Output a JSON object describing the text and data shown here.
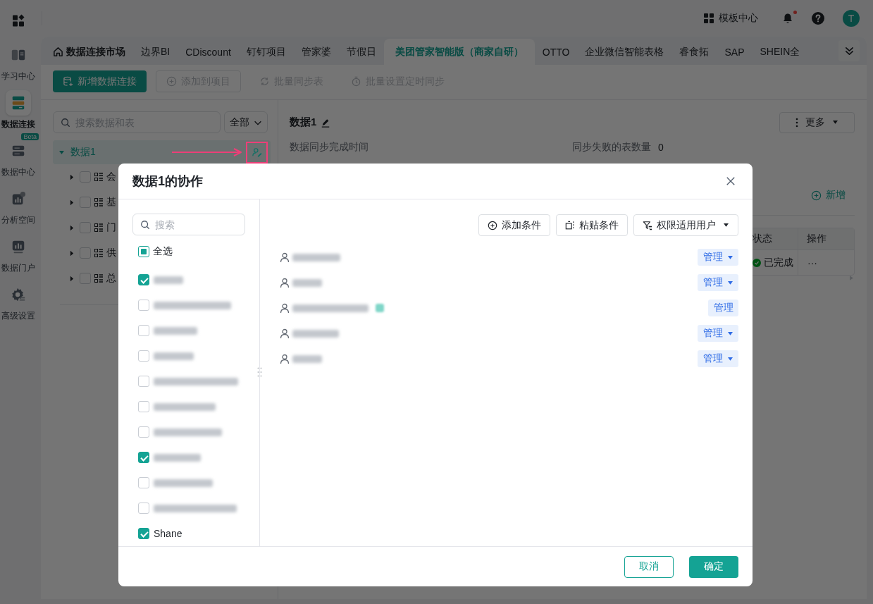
{
  "sidebar": {
    "items": [
      {
        "label": "学习中心",
        "selected": false
      },
      {
        "label": "数据连接",
        "selected": true
      },
      {
        "label": "数据中心",
        "selected": false,
        "badge": "Beta"
      },
      {
        "label": "分析空间",
        "selected": false
      },
      {
        "label": "数据门户",
        "selected": false
      },
      {
        "label": "高级设置",
        "selected": false
      }
    ]
  },
  "header": {
    "template_center": "模板中心",
    "notifications_unread": true,
    "avatar": "T"
  },
  "tabs": [
    {
      "label": "数据连接市场",
      "kind": "home",
      "selected": false
    },
    {
      "label": "边界BI",
      "kind": "source",
      "selected": false
    },
    {
      "label": "CDiscount",
      "kind": "source",
      "selected": false
    },
    {
      "label": "钉钉项目",
      "kind": "source",
      "selected": false
    },
    {
      "label": "管家婆",
      "kind": "source",
      "selected": false
    },
    {
      "label": "节假日",
      "kind": "source",
      "selected": false
    },
    {
      "label": "美团管家智能版（商家自研）",
      "kind": "source",
      "selected": true
    },
    {
      "label": "OTTO",
      "kind": "source",
      "selected": false
    },
    {
      "label": "企业微信智能表格",
      "kind": "source",
      "selected": false
    },
    {
      "label": "睿食拓",
      "kind": "source",
      "selected": false
    },
    {
      "label": "SAP",
      "kind": "source",
      "selected": false
    },
    {
      "label": "SHEIN全",
      "kind": "source",
      "selected": false
    }
  ],
  "toolbar": {
    "buttons": [
      {
        "label": "新增数据连接",
        "kind": "primary",
        "disabled": false
      },
      {
        "label": "添加到项目",
        "kind": "outline",
        "disabled": true
      },
      {
        "label": "批量同步表",
        "kind": "text",
        "disabled": true
      },
      {
        "label": "批量设置定时同步",
        "kind": "text",
        "disabled": true
      }
    ]
  },
  "tree": {
    "search": {
      "placeholder": "搜索数据和表"
    },
    "filter": "全部",
    "nodes": [
      {
        "label": "数据1",
        "expanded": true,
        "selected": true,
        "callout": true,
        "children": [
          {
            "label": "会",
            "expanded": false,
            "checked": false
          },
          {
            "label": "基",
            "expanded": false,
            "checked": false
          },
          {
            "label": "门",
            "expanded": false,
            "checked": false
          },
          {
            "label": "供",
            "expanded": false,
            "checked": false
          },
          {
            "label": "总",
            "expanded": false,
            "checked": false
          }
        ]
      }
    ]
  },
  "detail": {
    "title": "数据1",
    "more": "更多",
    "fields": [
      {
        "label": "数据同步完成时间"
      },
      {
        "label": "同步失败的表数量",
        "value": "0"
      }
    ],
    "add": "新增",
    "table": {
      "columns": [
        "状态",
        "操作"
      ],
      "rows": [
        {
          "status": "已完成",
          "action": "···"
        }
      ]
    }
  },
  "dialog": {
    "title": "数据1的协作",
    "search": {
      "placeholder": "搜索"
    },
    "select_all": {
      "label": "全选",
      "checked": false,
      "indeterminate": true
    },
    "members": [
      {
        "kind": "redacted",
        "checked": true
      },
      {
        "kind": "redacted",
        "checked": false
      },
      {
        "kind": "redacted",
        "checked": false
      },
      {
        "kind": "redacted",
        "checked": false
      },
      {
        "kind": "redacted",
        "checked": false
      },
      {
        "kind": "redacted",
        "checked": false
      },
      {
        "kind": "redacted",
        "checked": false
      },
      {
        "kind": "redacted",
        "checked": true
      },
      {
        "kind": "redacted",
        "checked": false
      },
      {
        "kind": "redacted",
        "checked": false
      },
      {
        "kind": "named",
        "name": "Shane",
        "checked": true
      }
    ],
    "actions": [
      {
        "label": "添加条件",
        "dropdown": false
      },
      {
        "label": "粘贴条件",
        "dropdown": false
      },
      {
        "label": "权限适用用户",
        "dropdown": true
      }
    ],
    "collaborators": [
      {
        "kind": "redacted",
        "role": "管理",
        "dropdown": true,
        "badge": false
      },
      {
        "kind": "redacted",
        "role": "管理",
        "dropdown": true,
        "badge": false
      },
      {
        "kind": "redacted",
        "role": "管理",
        "dropdown": false,
        "badge": true
      },
      {
        "kind": "redacted",
        "role": "管理",
        "dropdown": true,
        "badge": false
      },
      {
        "kind": "redacted",
        "role": "管理",
        "dropdown": true,
        "badge": false
      }
    ],
    "buttons": [
      {
        "label": "取消",
        "kind": "secondary"
      },
      {
        "label": "确定",
        "kind": "primary"
      }
    ]
  }
}
